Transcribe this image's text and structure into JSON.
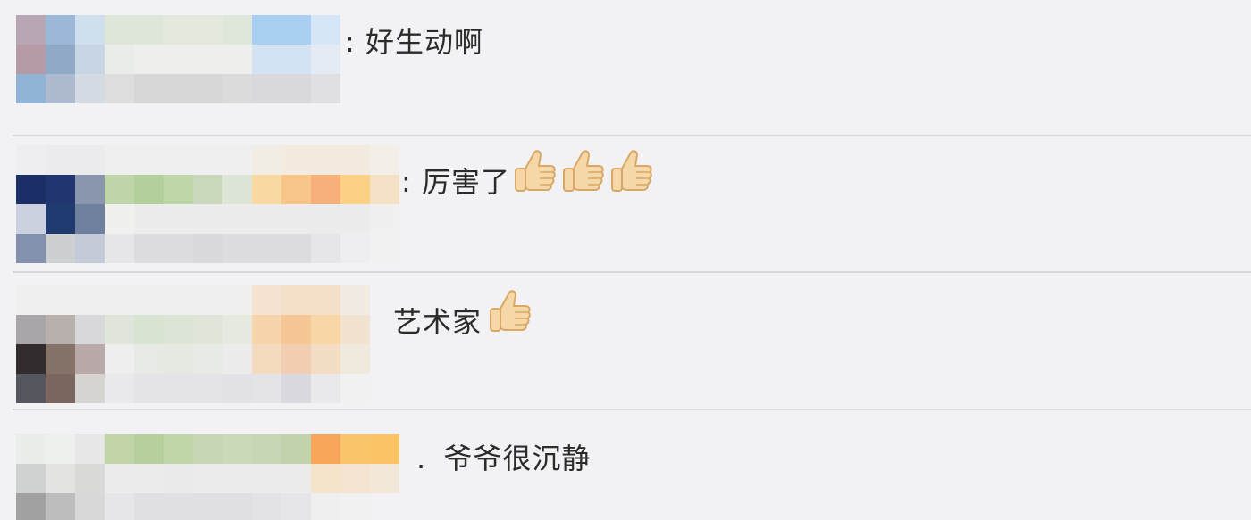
{
  "comments": [
    {
      "separator": ":",
      "text": "好生动啊",
      "thumbs_count": 0
    },
    {
      "separator": ":",
      "text": "厉害了",
      "thumbs_count": 3
    },
    {
      "separator": "",
      "text": "艺术家",
      "thumbs_count": 1
    },
    {
      "separator": ".",
      "text": "爷爷很沉静",
      "thumbs_count": 0
    }
  ],
  "icons": {
    "reaction": "thumbs-up-icon"
  },
  "colors": {
    "background": "#f2f2f4",
    "divider": "#d8d8dc",
    "text": "#2b2b2b",
    "thumb_fill": "#f6d8a8",
    "thumb_outline": "#d9a866"
  }
}
